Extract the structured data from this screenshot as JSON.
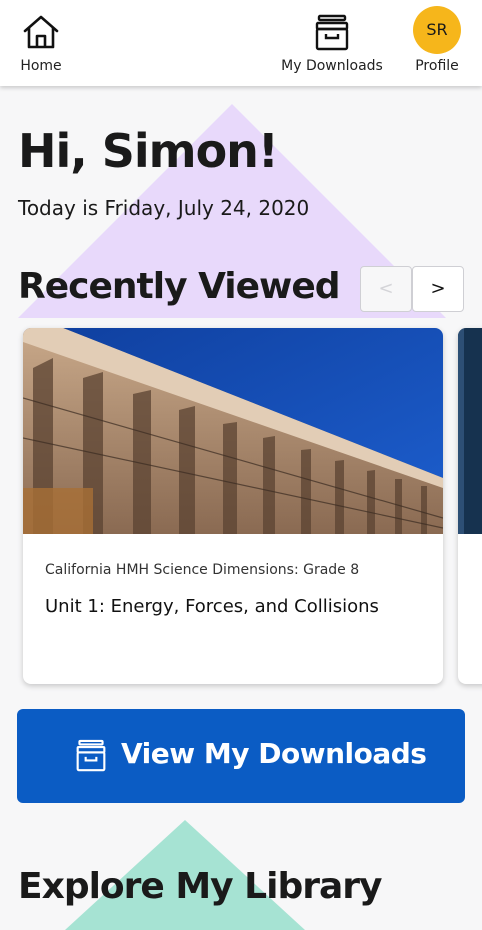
{
  "nav": {
    "home_label": "Home",
    "downloads_label": "My Downloads",
    "profile_label": "Profile",
    "avatar_initials": "SR",
    "avatar_color": "#f6b61b"
  },
  "greeting": "Hi, Simon!",
  "date_text": "Today is Friday, July 24, 2020",
  "recently_viewed": {
    "title": "Recently Viewed",
    "prev_label": "<",
    "next_label": ">",
    "cards": [
      {
        "subtitle": "California HMH Science Dimensions: Grade 8",
        "title": "Unit 1: Energy, Forces, and Collisions",
        "image": "dam-photo"
      }
    ]
  },
  "cta": {
    "label": "View My Downloads",
    "icon": "archive-box-icon",
    "color": "#0b5cc4"
  },
  "explore_title": "Explore My Library",
  "colors": {
    "accent_purple": "#e8d9fb",
    "accent_green": "#a6e3d3"
  }
}
